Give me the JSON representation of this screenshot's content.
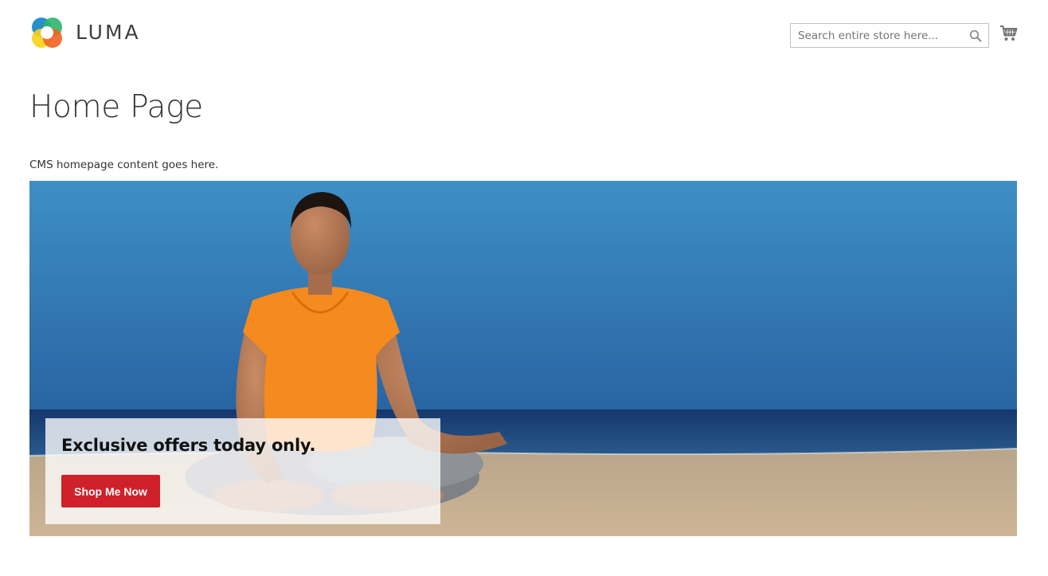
{
  "header": {
    "logo_text": "LUMA",
    "search": {
      "placeholder": "Search entire store here...",
      "value": "",
      "button_icon": "search-icon"
    },
    "cart_icon": "cart-icon"
  },
  "main": {
    "page_title": "Home Page",
    "cms_text": "CMS homepage content goes here.",
    "banner": {
      "image": "woman-meditating-on-beach",
      "promo_title": "Exclusive offers today only.",
      "button_label": "Shop Me Now"
    }
  },
  "colors": {
    "accent_button": "#d0202a",
    "text": "#333333",
    "logo_orange": "#f26322",
    "logo_green": "#2fb56a",
    "logo_blue": "#1e88c9",
    "logo_yellow": "#f7d117"
  }
}
